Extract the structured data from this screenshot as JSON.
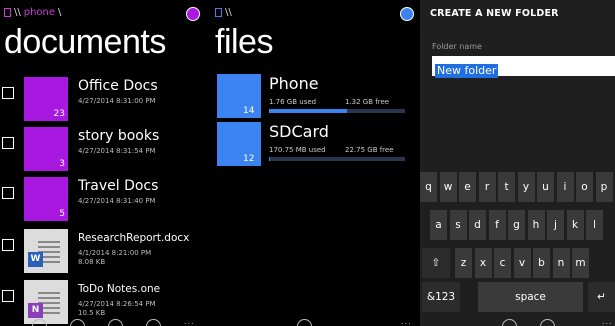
{
  "documents_screen": {
    "crumb_root": "\\\\",
    "crumb_current": "phone",
    "crumb_trail": "\\",
    "title": "documents",
    "accent_color": "#a818e0",
    "items": [
      {
        "type": "folder",
        "name": "Office Docs",
        "date": "4/27/2014 8:31:00 PM",
        "count": "23"
      },
      {
        "type": "folder",
        "name": "story books",
        "date": "4/27/2014 8:31:54 PM",
        "count": "3"
      },
      {
        "type": "folder",
        "name": "Travel Docs",
        "date": "4/27/2014 8:31:40 PM",
        "count": "5"
      },
      {
        "type": "word",
        "name": "ResearchReport.docx",
        "date": "4/1/2014 8:21:00 PM",
        "size": "8.08 KB",
        "badge": "W"
      },
      {
        "type": "onenote",
        "name": "ToDo Notes.one",
        "date": "4/27/2014 8:26:54 PM",
        "size": "10.5 KB",
        "badge": "N"
      }
    ]
  },
  "files_screen": {
    "crumb_root": "\\\\",
    "title": "files",
    "accent_color": "#3b83f0",
    "storage": [
      {
        "name": "Phone",
        "count": "14",
        "used": "1.76 GB used",
        "free": "1.32 GB free",
        "used_fraction": 0.57
      },
      {
        "name": "SDCard",
        "count": "12",
        "used": "170.75 MB used",
        "free": "22.75 GB free",
        "used_fraction": 0.01
      }
    ]
  },
  "create_folder": {
    "title": "CREATE A NEW FOLDER",
    "field_label": "Folder name",
    "field_value": "New folder",
    "keyboard": {
      "row1": [
        "q",
        "w",
        "e",
        "r",
        "t",
        "y",
        "u",
        "i",
        "o",
        "p"
      ],
      "row2": [
        "a",
        "s",
        "d",
        "f",
        "g",
        "h",
        "j",
        "k",
        "l"
      ],
      "row3": [
        "z",
        "x",
        "c",
        "v",
        "b",
        "n",
        "m"
      ],
      "symbols_key": "&123",
      "space_key": "space"
    }
  },
  "app_bar": {
    "more_label": "..."
  }
}
